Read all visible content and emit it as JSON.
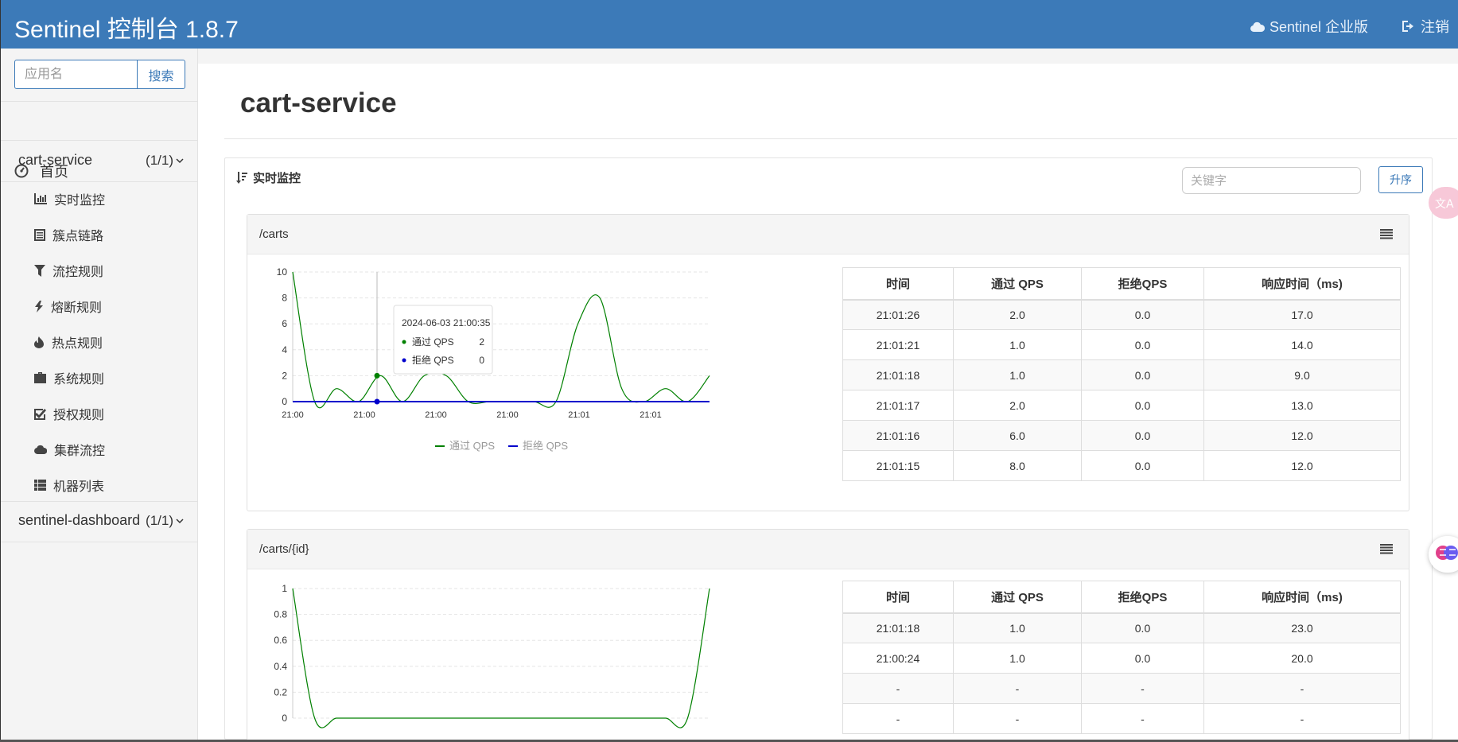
{
  "header": {
    "title": "Sentinel 控制台 1.8.7",
    "enterprise_label": "Sentinel 企业版",
    "logout_label": "注销"
  },
  "sidebar": {
    "search_placeholder": "应用名",
    "search_button": "搜索",
    "home_label": "首页",
    "apps": [
      {
        "name": "cart-service",
        "count": "(1/1)"
      },
      {
        "name": "sentinel-dashboard",
        "count": "(1/1)"
      }
    ],
    "sub_items": [
      {
        "label": "实时监控",
        "icon": "bar-chart-icon"
      },
      {
        "label": "簇点链路",
        "icon": "list-alt-icon"
      },
      {
        "label": "流控规则",
        "icon": "filter-icon"
      },
      {
        "label": "熔断规则",
        "icon": "flash-icon"
      },
      {
        "label": "热点规则",
        "icon": "fire-icon"
      },
      {
        "label": "系统规则",
        "icon": "briefcase-icon"
      },
      {
        "label": "授权规则",
        "icon": "check-icon"
      },
      {
        "label": "集群流控",
        "icon": "cloud-icon"
      },
      {
        "label": "机器列表",
        "icon": "th-list-icon"
      }
    ]
  },
  "main": {
    "page_title": "cart-service",
    "panel_title": "实时监控",
    "keyword_placeholder": "关键字",
    "sort_button": "升序",
    "table_headers": [
      "时间",
      "通过 QPS",
      "拒绝QPS",
      "响应时间（ms)"
    ],
    "cards": [
      {
        "resource": "/carts",
        "rows": [
          [
            "21:01:26",
            "2.0",
            "0.0",
            "17.0"
          ],
          [
            "21:01:21",
            "1.0",
            "0.0",
            "14.0"
          ],
          [
            "21:01:18",
            "1.0",
            "0.0",
            "9.0"
          ],
          [
            "21:01:17",
            "2.0",
            "0.0",
            "13.0"
          ],
          [
            "21:01:16",
            "6.0",
            "0.0",
            "12.0"
          ],
          [
            "21:01:15",
            "8.0",
            "0.0",
            "12.0"
          ]
        ]
      },
      {
        "resource": "/carts/{id}",
        "rows": [
          [
            "21:01:18",
            "1.0",
            "0.0",
            "23.0"
          ],
          [
            "21:00:24",
            "1.0",
            "0.0",
            "20.0"
          ],
          [
            "-",
            "-",
            "-",
            "-"
          ],
          [
            "-",
            "-",
            "-",
            "-"
          ]
        ]
      }
    ],
    "tooltip": {
      "time": "2024-06-03 21:00:35",
      "pass_label": "通过 QPS",
      "pass_value": "2",
      "block_label": "拒绝 QPS",
      "block_value": "0"
    },
    "legend": {
      "pass": "通过 QPS",
      "block": "拒绝 QPS"
    }
  },
  "colors": {
    "header": "#3c7ab8",
    "pass_series": "#008000",
    "block_series": "#0000cc"
  },
  "chart_data": [
    {
      "type": "line",
      "title": "/carts",
      "x": [
        "21:00",
        "21:00",
        "21:00",
        "21:00",
        "21:01",
        "21:01"
      ],
      "ylim": [
        0,
        10
      ],
      "yticks": [
        "0",
        "2",
        "4",
        "6",
        "8",
        "10"
      ],
      "series": [
        {
          "name": "通过 QPS",
          "values": [
            10,
            0,
            1,
            0,
            2,
            0,
            2,
            2,
            0,
            0,
            0,
            0,
            0,
            6,
            8,
            1,
            0,
            1,
            0,
            2
          ]
        },
        {
          "name": "拒绝 QPS",
          "values": [
            0,
            0,
            0,
            0,
            0,
            0,
            0,
            0,
            0,
            0,
            0,
            0,
            0,
            0,
            0,
            0,
            0,
            0,
            0,
            0
          ]
        }
      ]
    },
    {
      "type": "line",
      "title": "/carts/{id}",
      "ylim": [
        0,
        1
      ],
      "yticks": [
        "0",
        "0.2",
        "0.4",
        "0.6",
        "0.8",
        "1"
      ],
      "series": [
        {
          "name": "通过 QPS",
          "values": [
            1,
            0,
            0,
            0,
            0,
            0,
            0,
            0,
            0,
            0,
            0,
            0,
            0,
            0,
            0,
            0,
            0,
            0,
            0,
            1
          ]
        }
      ]
    }
  ]
}
